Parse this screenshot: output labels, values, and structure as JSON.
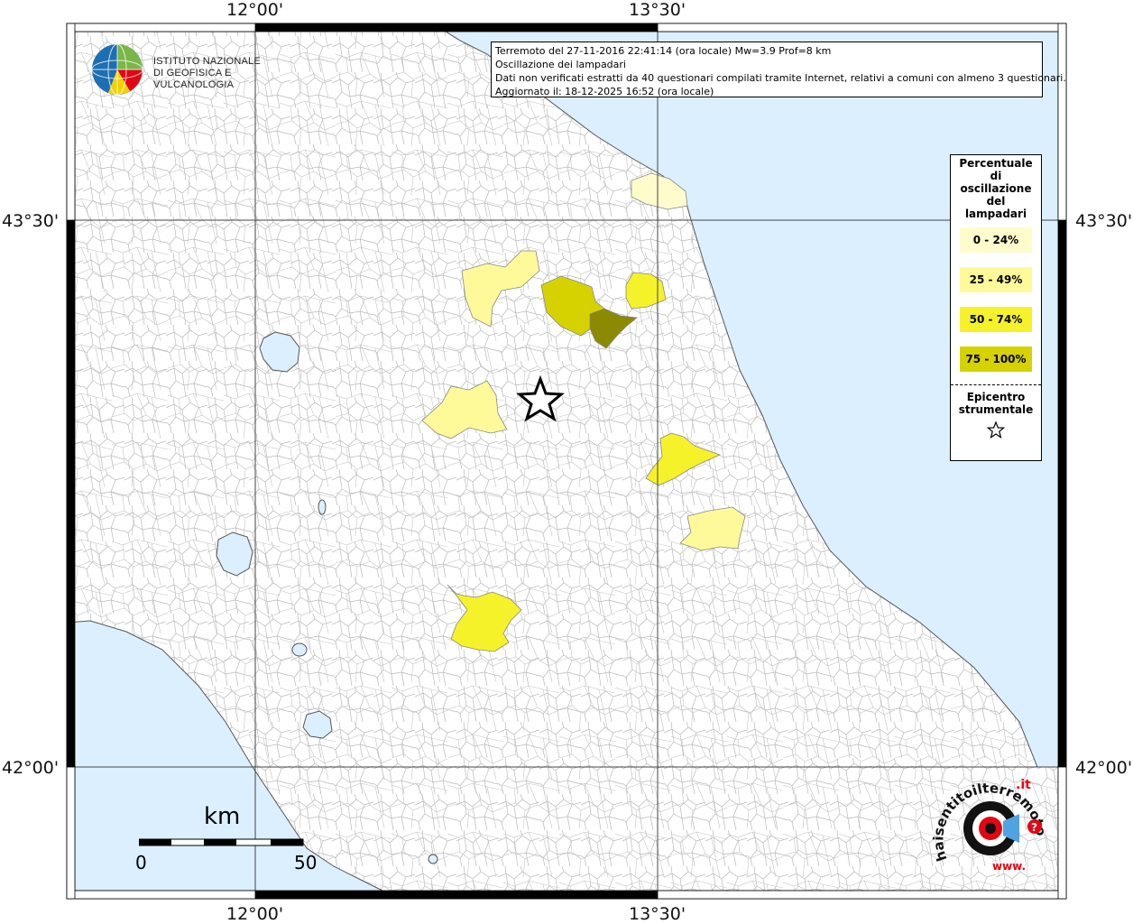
{
  "info": {
    "line1": "Terremoto del 27-11-2016 22:41:14 (ora locale) Mw=3.9 Prof=8 km",
    "line2": "Oscillazione dei lampadari",
    "line3": "Dati non verificati estratti da 40 questionari compilati tramite Internet, relativi a comuni con almeno 3 questionari.",
    "line4": "Aggiornato il: 18-12-2025 16:52 (ora locale)"
  },
  "ticks": {
    "top_left": "12°00'",
    "top_right": "13°30'",
    "bottom_left": "12°00'",
    "bottom_right": "13°30'",
    "left_upper": "43°30'",
    "left_lower": "42°00'",
    "right_upper": "43°30'",
    "right_lower": "42°00'"
  },
  "legend": {
    "title_lines": [
      "Percentuale",
      "di",
      "oscillazione",
      "del",
      "lampadari"
    ],
    "classes": [
      {
        "label": "0 - 24%",
        "color": "#fffccc"
      },
      {
        "label": "25 - 49%",
        "color": "#fffa99"
      },
      {
        "label": "50 - 74%",
        "color": "#f6f22a"
      },
      {
        "label": "75 - 100%",
        "color": "#d6d200"
      }
    ],
    "epicenter_lines": [
      "Epicentro",
      "strumentale"
    ],
    "epicenter_icon": "star-outline-icon"
  },
  "logo": {
    "line1": "ISTITUTO NAZIONALE",
    "line2": "DI GEOFISICA E VULCANOLOGIA"
  },
  "scale": {
    "unit": "km",
    "min": "0",
    "max": "50"
  },
  "hst": {
    "text_main": "haisentitoilterremoto",
    "text_it": ".it",
    "text_www": "www.",
    "text_q": "?"
  },
  "colors": {
    "sea": "#dcefff",
    "class_0_24": "#fffccc",
    "class_25_49": "#fffa99",
    "class_50_74": "#f6f22a",
    "class_75_100": "#d6d200",
    "class_dark": "#8c8a00",
    "brand_red": "#e30613"
  }
}
